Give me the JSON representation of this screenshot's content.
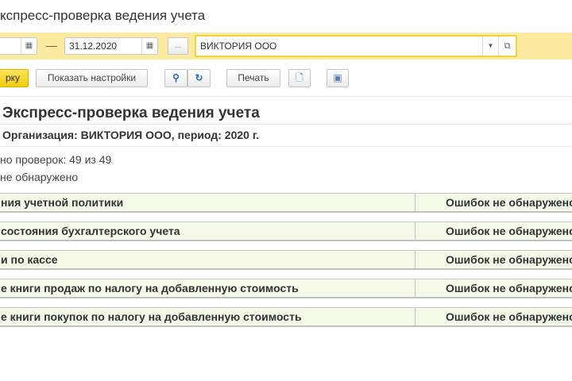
{
  "window": {
    "title": "кспресс-проверка ведения учета"
  },
  "filters": {
    "date_from": "",
    "date_separator": "—",
    "date_to": "31.12.2020",
    "select_period_label": "...",
    "organization": "ВИКТОРИЯ ООО"
  },
  "toolbar": {
    "run_label": "рку",
    "settings_label": "Показать настройки",
    "print_label": "Печать"
  },
  "report": {
    "title": "Экспресс-проверка ведения учета",
    "subtitle": "Организация: ВИКТОРИЯ ООО, период: 2020 г.",
    "checks_done": "но проверок: 49 из 49",
    "summary": "не обнаружено",
    "rows": [
      {
        "name": "ния учетной политики",
        "status": "Ошибок не обнаружено"
      },
      {
        "name": "состояния бухгалтерского учета",
        "status": "Ошибок не обнаружено"
      },
      {
        "name": "и по кассе",
        "status": "Ошибок не обнаружено"
      },
      {
        "name": "е книги продаж по налогу на добавленную стоимость",
        "status": "Ошибок не обнаружено"
      },
      {
        "name": "е книги покупок по налогу на добавленную стоимость",
        "status": "Ошибок не обнаружено"
      }
    ]
  },
  "colors": {
    "accent": "#fbeaa0",
    "run_button": "#f5d630",
    "row_bg": "#f4f9e8"
  }
}
